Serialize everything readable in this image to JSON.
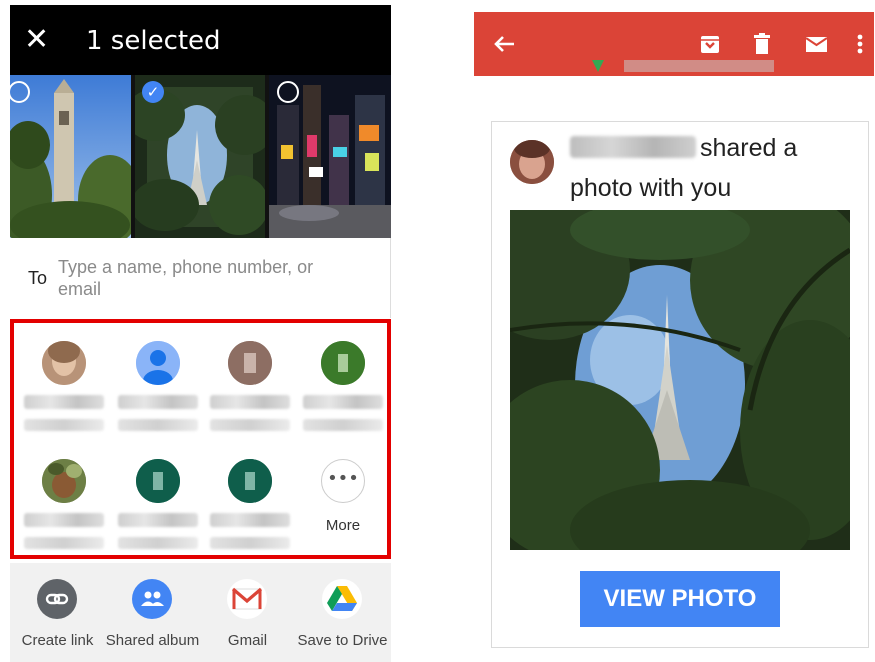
{
  "share_sheet": {
    "title": "1 selected",
    "close_icon": "close-icon",
    "photos": [
      {
        "subject": "clock tower",
        "selected": false
      },
      {
        "subject": "spire through trees",
        "selected": true
      },
      {
        "subject": "times square at night",
        "selected": false
      }
    ],
    "to_label": "To",
    "to_placeholder": "Type a name, phone number, or email",
    "more_label": "More",
    "apps": [
      {
        "label": "Create link",
        "icon": "link-icon",
        "color": "#5f6368"
      },
      {
        "label": "Shared album",
        "icon": "shared-album-icon",
        "color": "#4285f4"
      },
      {
        "label": "Gmail",
        "icon": "gmail-icon",
        "color": "#ffffff"
      },
      {
        "label": "Save to Drive",
        "icon": "drive-icon",
        "color": "#ffffff"
      }
    ]
  },
  "email": {
    "toolbar_color": "#db4437",
    "toolbar_icons": [
      "back-arrow-icon",
      "archive-icon",
      "delete-icon",
      "mail-icon",
      "more-vert-icon"
    ],
    "shared_text": "shared a photo with you",
    "button_label": "VIEW PHOTO",
    "button_color": "#4285f4"
  },
  "highlight_color": "#e30000"
}
